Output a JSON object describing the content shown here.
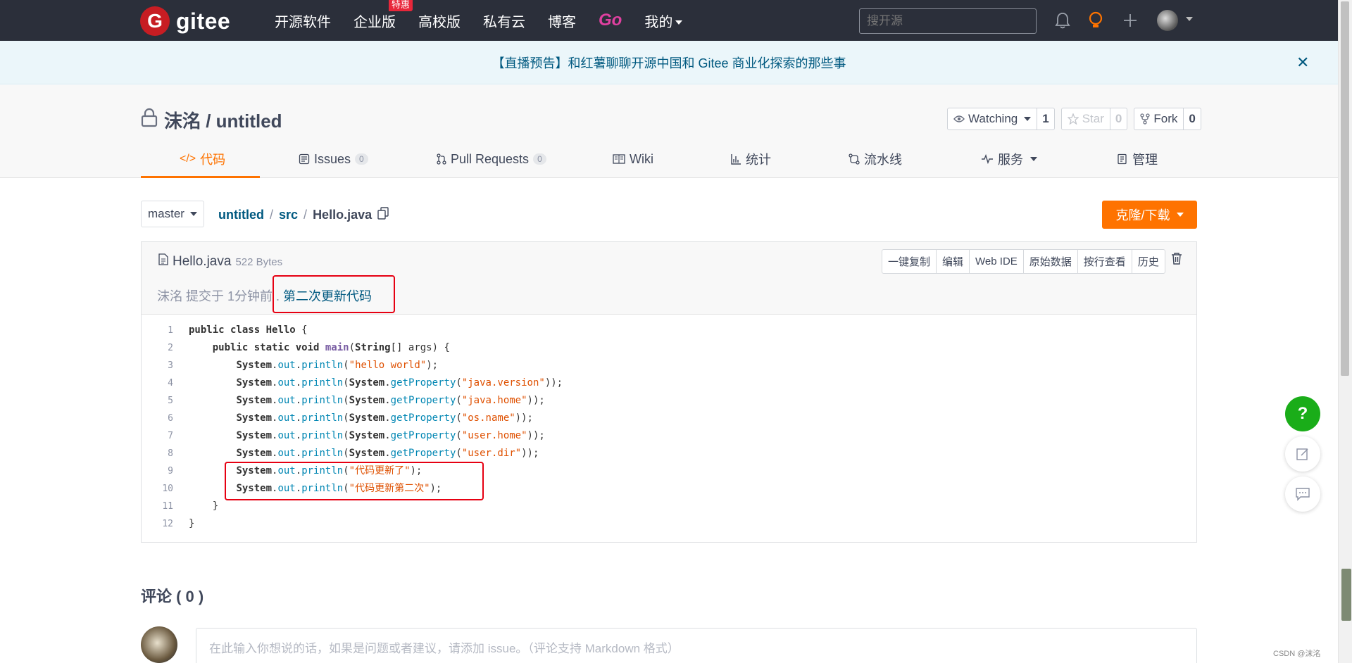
{
  "nav": {
    "logo_mark": "G",
    "logo_text": "gitee",
    "links": [
      "开源软件",
      "企业版",
      "高校版",
      "私有云",
      "博客",
      "Go",
      "我的"
    ],
    "badge": "特惠",
    "search_placeholder": "搜开源"
  },
  "banner": {
    "text": "【直播预告】和红薯聊聊开源中国和 Gitee 商业化探索的那些事",
    "close": "✕"
  },
  "repo": {
    "title": "沫洺 / untitled",
    "watching_label": "Watching",
    "watching_count": "1",
    "star_label": "Star",
    "star_count": "0",
    "fork_label": "Fork",
    "fork_count": "0",
    "tabs": [
      {
        "label": "代码"
      },
      {
        "label": "Issues",
        "count": "0"
      },
      {
        "label": "Pull Requests",
        "count": "0"
      },
      {
        "label": "Wiki"
      },
      {
        "label": "统计"
      },
      {
        "label": "流水线"
      },
      {
        "label": "服务"
      },
      {
        "label": "管理"
      }
    ]
  },
  "path": {
    "branch": "master",
    "crumbs": [
      "untitled",
      "src"
    ],
    "current": "Hello.java",
    "clone_label": "克隆/下载"
  },
  "file": {
    "name": "Hello.java",
    "size": "522 Bytes",
    "commit_author_time": "沫洺 提交于 1分钟前 .",
    "commit_message": "第二次更新代码",
    "buttons": [
      "一键复制",
      "编辑",
      "Web IDE",
      "原始数据",
      "按行查看",
      "历史"
    ]
  },
  "code_line_numbers": [
    "1",
    "2",
    "3",
    "4",
    "5",
    "6",
    "7",
    "8",
    "9",
    "10",
    "11",
    "12"
  ],
  "code_strings": [
    "\"hello world\"",
    "\"java.version\"",
    "\"java.home\"",
    "\"os.name\"",
    "\"user.home\"",
    "\"user.dir\"",
    "\"代码更新了\"",
    "\"代码更新第二次\""
  ],
  "comments": {
    "title": "评论 ( 0 )",
    "placeholder": "在此输入你想说的话，如果是问题或者建议，请添加 issue。（评论支持 Markdown 格式）"
  },
  "fab_help": "?",
  "watermark": "CSDN @沫洺",
  "colors": {
    "nav_bg": "#2b2f3a",
    "accent": "#fe7300",
    "link": "#005980",
    "highlight_box": "#e60012",
    "help_fab": "#1aad19"
  }
}
